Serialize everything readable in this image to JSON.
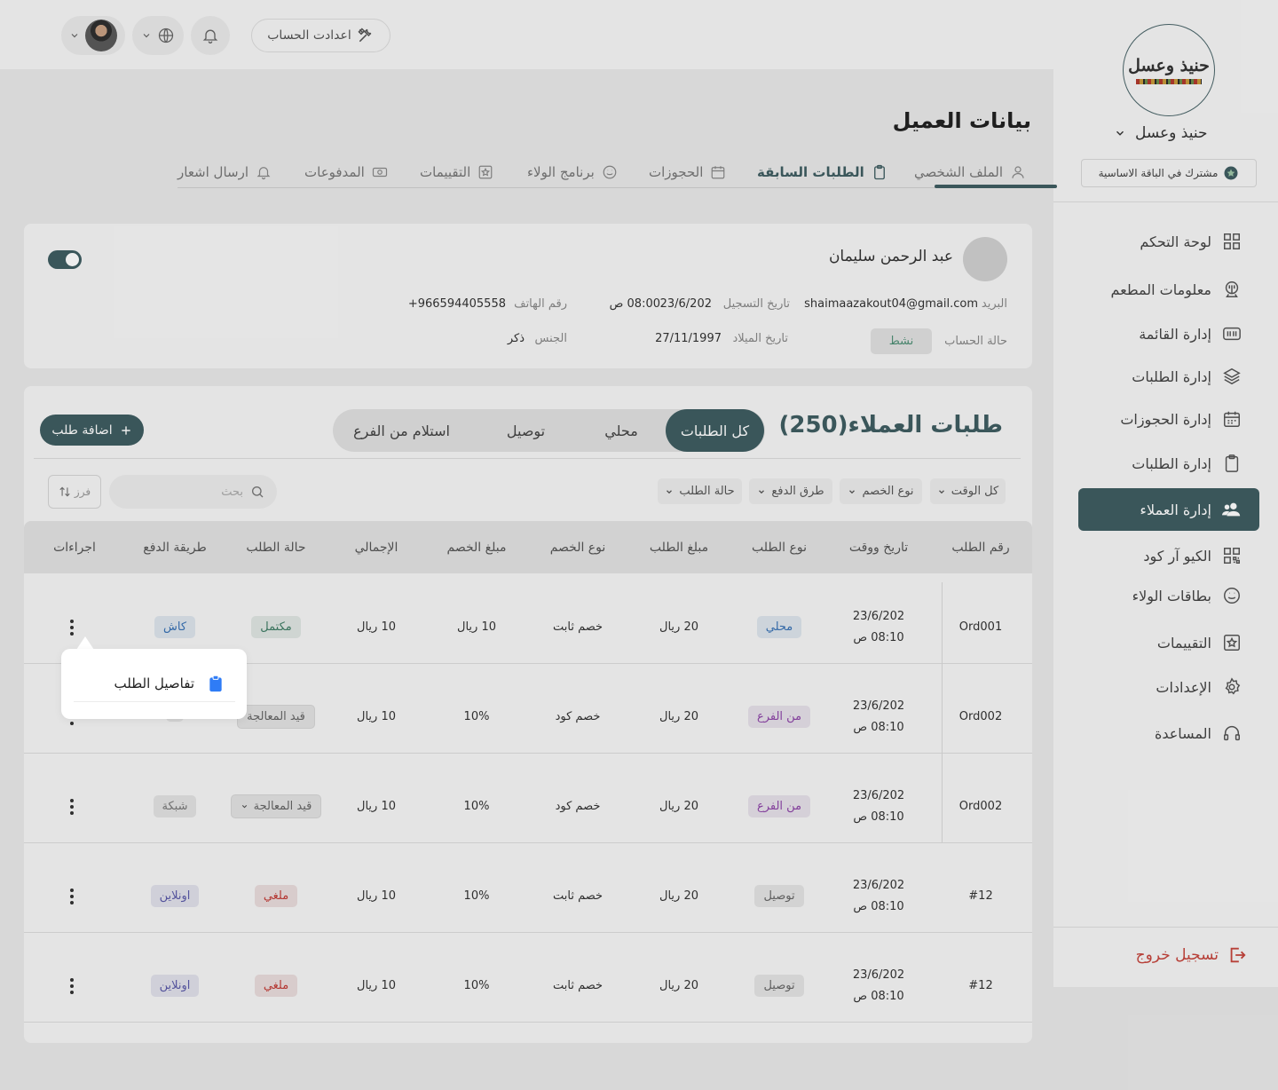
{
  "header": {
    "account_settings": "اعدادت الحساب"
  },
  "sidebar": {
    "logo_text": "حنيذ وعسل",
    "brand_name": "حنيذ وعسل",
    "plan": "مشترك في الباقة الاساسية",
    "items": [
      {
        "label": "لوحة التحكم",
        "icon": "grid-icon"
      },
      {
        "label": "معلومات المطعم",
        "icon": "restaurant-icon"
      },
      {
        "label": "إدارة القائمة",
        "icon": "menu-icon"
      },
      {
        "label": "إدارة الطلبات",
        "icon": "layers-icon"
      },
      {
        "label": "إدارة الحجوزات",
        "icon": "calendar-icon"
      },
      {
        "label": "إدارة الطلبات",
        "icon": "clipboard-icon"
      },
      {
        "label": "إدارة العملاء",
        "icon": "users-icon"
      },
      {
        "label": "الكيو آر كود",
        "icon": "qr-icon"
      },
      {
        "label": "بطاقات الولاء",
        "icon": "smile-icon"
      },
      {
        "label": "التقييمات",
        "icon": "star-icon"
      },
      {
        "label": "الإعدادات",
        "icon": "gear-icon"
      },
      {
        "label": "المساعدة",
        "icon": "headset-icon"
      }
    ],
    "logout": "تسجيل خروج"
  },
  "page": {
    "title": "بيانات العميل",
    "tabs": [
      {
        "label": "الملف الشخصي"
      },
      {
        "label": "الطلبات السابقة"
      },
      {
        "label": "الحجوزات"
      },
      {
        "label": "برنامج الولاء"
      },
      {
        "label": "التقييمات"
      },
      {
        "label": "المدفوعات"
      },
      {
        "label": "ارسال اشعار"
      }
    ]
  },
  "customer": {
    "name": "عبد الرحمن سليمان",
    "email_label": "البريد",
    "email": "shaimaazakout04@gmail.com",
    "reg_label": "تاريخ التسجيل",
    "reg_date": "23/6/202",
    "reg_time": "08:00 ص",
    "phone_label": "رقم الهاتف",
    "phone": "+966594405558",
    "status_label": "حالة الحساب",
    "status": "نشط",
    "birth_label": "تاريخ الميلاد",
    "birth": "27/11/1997",
    "gender_label": "الجنس",
    "gender": "ذكر"
  },
  "orders": {
    "title": "طلبات العملاء(250)",
    "segments": [
      "كل الطلبات",
      "محلي",
      "توصيل",
      "استلام من الفرع"
    ],
    "add_button": "اضافة طلب",
    "filters": [
      "كل الوقت",
      "نوع الخصم",
      "طرق الدفع",
      "حالة الطلب"
    ],
    "search_placeholder": "بحث",
    "sort_label": "فرز",
    "columns": [
      "رقم الطلب",
      "تاريخ ووقت",
      "نوع الطلب",
      "مبلغ الطلب",
      "نوع الخصم",
      "مبلغ الخصم",
      "الإجمالي",
      "حالة الطلب",
      "طريقة الدفع",
      "اجراءات"
    ],
    "rows": [
      {
        "id": "Ord001",
        "date": "23/6/202",
        "time": "08:10 ص",
        "type": "محلي",
        "amount": "20 ريال",
        "discount_type": "خصم ثابت",
        "discount": "10 ريال",
        "total": "10 ريال",
        "status": "مكتمل",
        "payment": "كاش"
      },
      {
        "id": "Ord002",
        "date": "23/6/202",
        "time": "08:10 ص",
        "type": "من الفرع",
        "amount": "20 ريال",
        "discount_type": "خصم كود",
        "discount": "10%",
        "total": "10 ريال",
        "status": "قيد المعالجة",
        "payment": ""
      },
      {
        "id": "Ord002",
        "date": "23/6/202",
        "time": "08:10 ص",
        "type": "من الفرع",
        "amount": "20 ريال",
        "discount_type": "خصم كود",
        "discount": "10%",
        "total": "10 ريال",
        "status": "قيد المعالجة",
        "payment": "شبكة"
      },
      {
        "id": "#12",
        "date": "23/6/202",
        "time": "08:10 ص",
        "type": "توصيل",
        "amount": "20 ريال",
        "discount_type": "خصم ثابت",
        "discount": "10%",
        "total": "10 ريال",
        "status": "ملغي",
        "payment": "اونلاين"
      },
      {
        "id": "#12",
        "date": "23/6/202",
        "time": "08:10 ص",
        "type": "توصيل",
        "amount": "20 ريال",
        "discount_type": "خصم ثابت",
        "discount": "10%",
        "total": "10 ريال",
        "status": "ملغي",
        "payment": "اونلاين"
      }
    ]
  },
  "popup": {
    "item": "تفاصيل الطلب"
  },
  "colors": {
    "primary": "#3f5d61",
    "danger": "#c5453d"
  }
}
